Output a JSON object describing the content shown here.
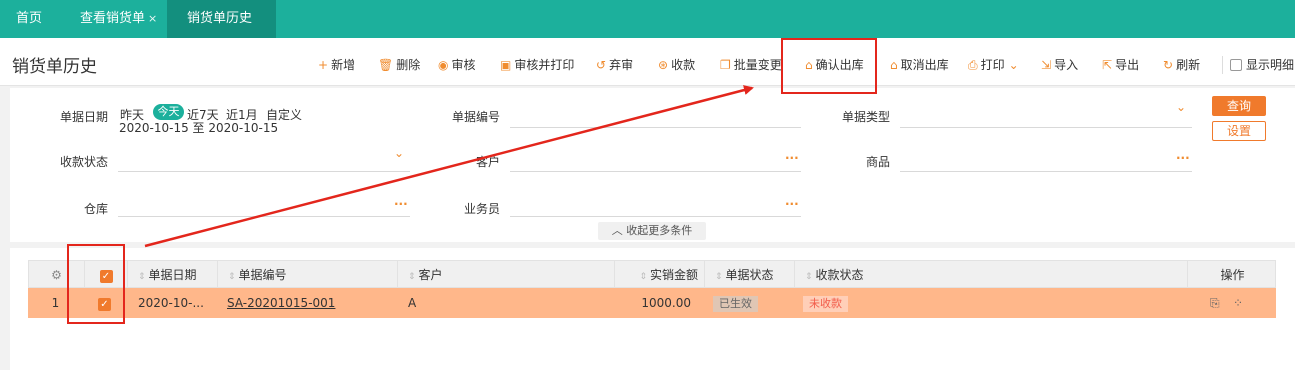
{
  "tabs": [
    {
      "label": "首页",
      "close": ""
    },
    {
      "label": "查看销货单",
      "close": "×"
    },
    {
      "label": "销货单历史",
      "close": "×"
    }
  ],
  "page_title": "销货单历史",
  "toolbar": {
    "add": "新增",
    "delete": "删除",
    "audit": "审核",
    "audit_print": "审核并打印",
    "abandon": "弃审",
    "collect": "收款",
    "batch_change": "批量变更",
    "confirm_out": "确认出库",
    "cancel_out": "取消出库",
    "print": "打印",
    "import": "导入",
    "export": "导出",
    "refresh": "刷新",
    "show_detail": "显示明细"
  },
  "filters": {
    "doc_date_label": "单据日期",
    "date_presets": [
      "昨天",
      "今天",
      "近7天",
      "近1月",
      "自定义"
    ],
    "date_range": "2020-10-15 至 2020-10-15",
    "doc_no_label": "单据编号",
    "doc_type_label": "单据类型",
    "pay_status_label": "收款状态",
    "customer_label": "客户",
    "product_label": "商品",
    "warehouse_label": "仓库",
    "salesman_label": "业务员",
    "query": "查询",
    "settings": "设置",
    "collapse": "收起更多条件"
  },
  "table": {
    "headers": {
      "doc_date": "单据日期",
      "doc_no": "单据编号",
      "customer": "客户",
      "amount": "实销金额",
      "doc_status": "单据状态",
      "pay_status": "收款状态",
      "actions": "操作"
    },
    "rows": [
      {
        "index": "1",
        "doc_date": "2020-10-...",
        "doc_no": "SA-20201015-001",
        "customer": "A",
        "amount": "1000.00",
        "doc_status": "已生效",
        "pay_status": "未收款"
      }
    ]
  },
  "colors": {
    "brand": "#1cb09c",
    "accent": "#f07a2c",
    "row_selected": "#ffb78a",
    "annotation": "#e3261c"
  }
}
